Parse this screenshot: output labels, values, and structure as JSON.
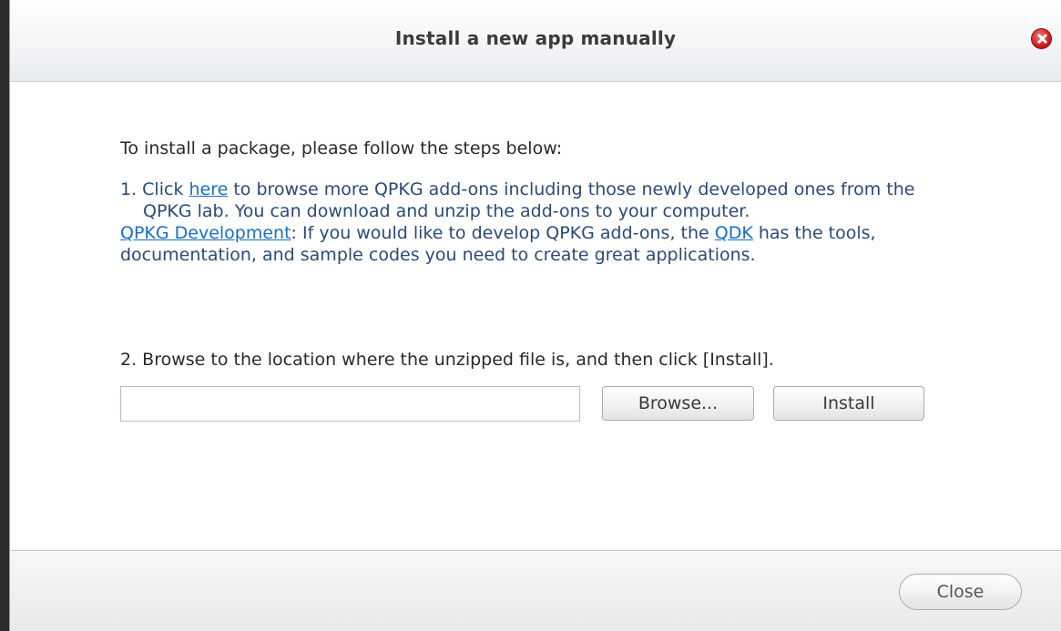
{
  "dialog": {
    "title": "Install a new app manually"
  },
  "content": {
    "intro": "To install a package, please follow the steps below:",
    "step1": {
      "prefix": "1. Click ",
      "link_here": "here",
      "suffix": " to browse more QPKG add-ons including those newly developed ones from the QPKG lab. You can download and unzip the add-ons to your computer."
    },
    "dev": {
      "link_dev": "QPKG Development",
      "text1": ": If you would like to develop QPKG add-ons, the ",
      "link_qdk": "QDK",
      "text2": " has the tools, documentation, and sample codes you need to create great applications."
    },
    "step2": "2. Browse to the location where the unzipped file is, and then click [Install].",
    "file_input_value": "",
    "browse_label": "Browse...",
    "install_label": "Install"
  },
  "footer": {
    "close_label": "Close"
  },
  "colors": {
    "link": "#1a6fc4",
    "step_text": "#2a4a78",
    "close_icon": "#d42020"
  },
  "icons": {
    "close": "close-circle-icon"
  }
}
